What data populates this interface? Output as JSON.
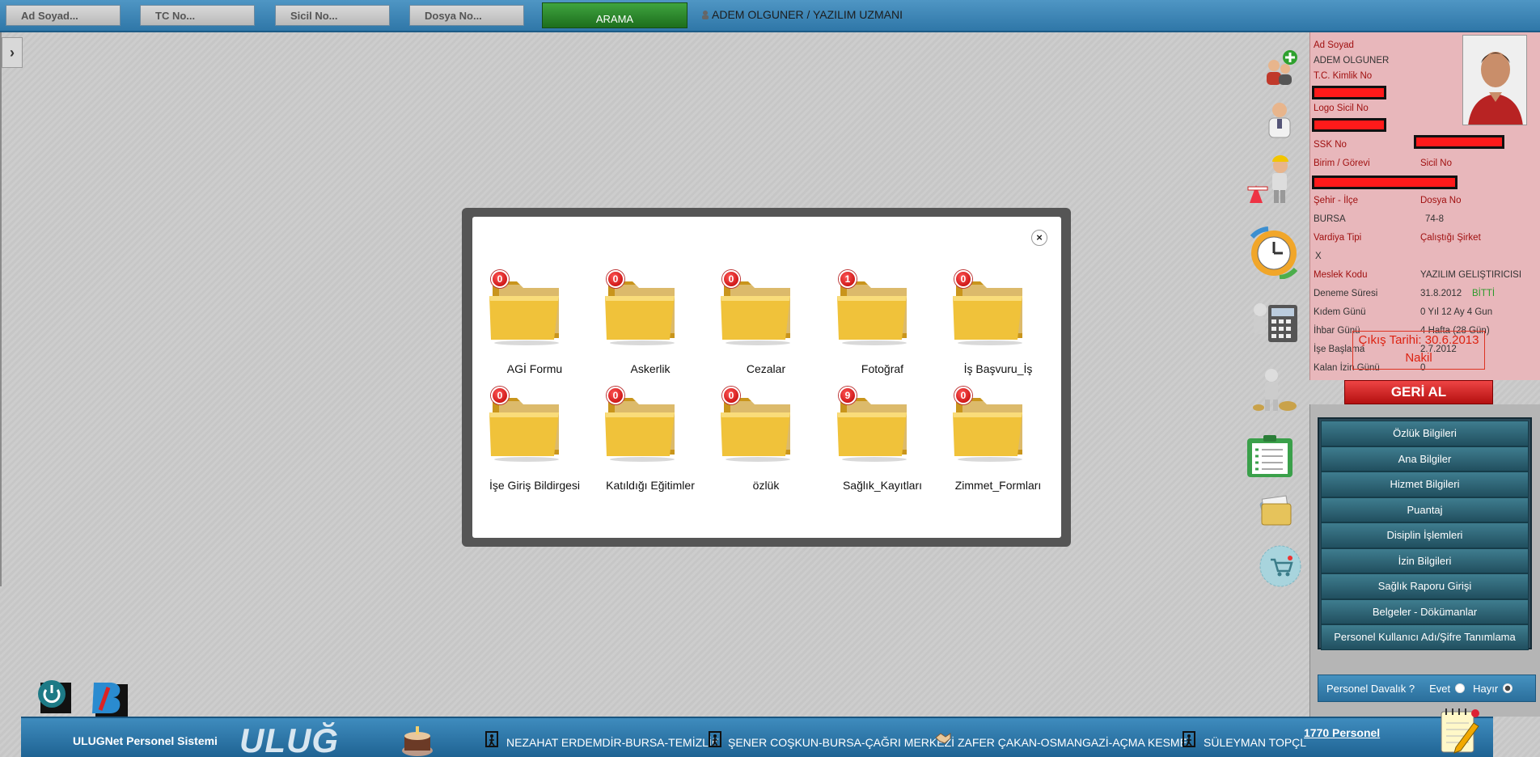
{
  "search": {
    "ad_soyad_placeholder": "Ad Soyad...",
    "tc_placeholder": "TC No...",
    "sicil_placeholder": "Sicil No...",
    "dosya_placeholder": "Dosya No...",
    "button_label": "ARAMA"
  },
  "header": {
    "user": "ADEM OLGUNER / YAZILIM UZMANI"
  },
  "modal": {
    "close_label": "×",
    "folders": [
      {
        "label": "AGİ Formu",
        "count": "0"
      },
      {
        "label": "Askerlik",
        "count": "0"
      },
      {
        "label": "Cezalar",
        "count": "0"
      },
      {
        "label": "Fotoğraf",
        "count": "1"
      },
      {
        "label": "İş Başvuru_İş",
        "count": "0"
      },
      {
        "label": "İşe Giriş Bildirgesi",
        "count": "0"
      },
      {
        "label": "Katıldığı Eğitimler",
        "count": "0"
      },
      {
        "label": "özlük",
        "count": "0"
      },
      {
        "label": "Sağlık_Kayıtları",
        "count": "9"
      },
      {
        "label": "Zimmet_Formları",
        "count": "0"
      }
    ]
  },
  "profile": {
    "ad_soyad_label": "Ad Soyad",
    "ad_soyad": "ADEM OLGUNER",
    "tc_label": "T.C. Kimlik No",
    "logo_sicil_label": "Logo Sicil No",
    "ssk_label": "SSK No",
    "birim_label": "Birim / Görevi",
    "sicil_label": "Sicil No",
    "sehir_label": "Şehir - İlçe",
    "dosya_label": "Dosya No",
    "sehir": "BURSA",
    "dosya": "74-8",
    "vardiya_label": "Vardiya Tipi",
    "calistigi_label": "Çalıştığı Şirket",
    "vardiya": "X",
    "meslek_label": "Meslek Kodu",
    "meslek": "YAZILIM GELİŞTİRİCİSİ",
    "deneme_label": "Deneme Süresi",
    "deneme": "31.8.2012",
    "deneme_status": "BİTTİ",
    "kidem_label": "Kıdem Günü",
    "kidem": "0 Yıl 12 Ay 4 Gun",
    "ihbar_label": "İhbar Günü",
    "ihbar": "4 Hafta (28 Gün)",
    "ise_baslama_label": "İşe Başlama",
    "ise_baslama": "2.7.2012",
    "kalan_izin_label": "Kalan İzin Günü",
    "kalan_izin": "0",
    "cikis_tarihi": "Çıkış Tarihi: 30.6.2013",
    "nakil": "Nakil",
    "geri_al": "GERİ AL"
  },
  "menu": [
    "Özlük Bilgileri",
    "Ana Bilgiler",
    "Hizmet Bilgileri",
    "Puantaj",
    "Disiplin İşlemleri",
    "İzin Bilgileri",
    "Sağlık Raporu Girişi",
    "Belgeler - Dökümanlar",
    "Personel Kullanıcı Adı/Şifre Tanımlama"
  ],
  "davalik": {
    "label": "Personel Davalık ?",
    "evet": "Evet",
    "hayir": "Hayır"
  },
  "footer": {
    "system_name": "ULUGNet Personel Sistemi",
    "logo_text": "ULUĞ",
    "ticker": [
      "NEZAHAT ERDEMDİR-BURSA-TEMİZLİK",
      "ŞENER COŞKUN-BURSA-ÇAĞRI MERKEZİ",
      "ZAFER ÇAKAN-OSMANGAZİ-AÇMA KESME",
      "SÜLEYMAN TOPÇL"
    ],
    "personel_count": "1770 Personel"
  },
  "colors": {
    "topbar": "#3a84b6",
    "profile_bg": "#e8b7bb",
    "label_red": "#a01010",
    "menu_bg": "#2d6271",
    "badge_red": "#d01010"
  }
}
